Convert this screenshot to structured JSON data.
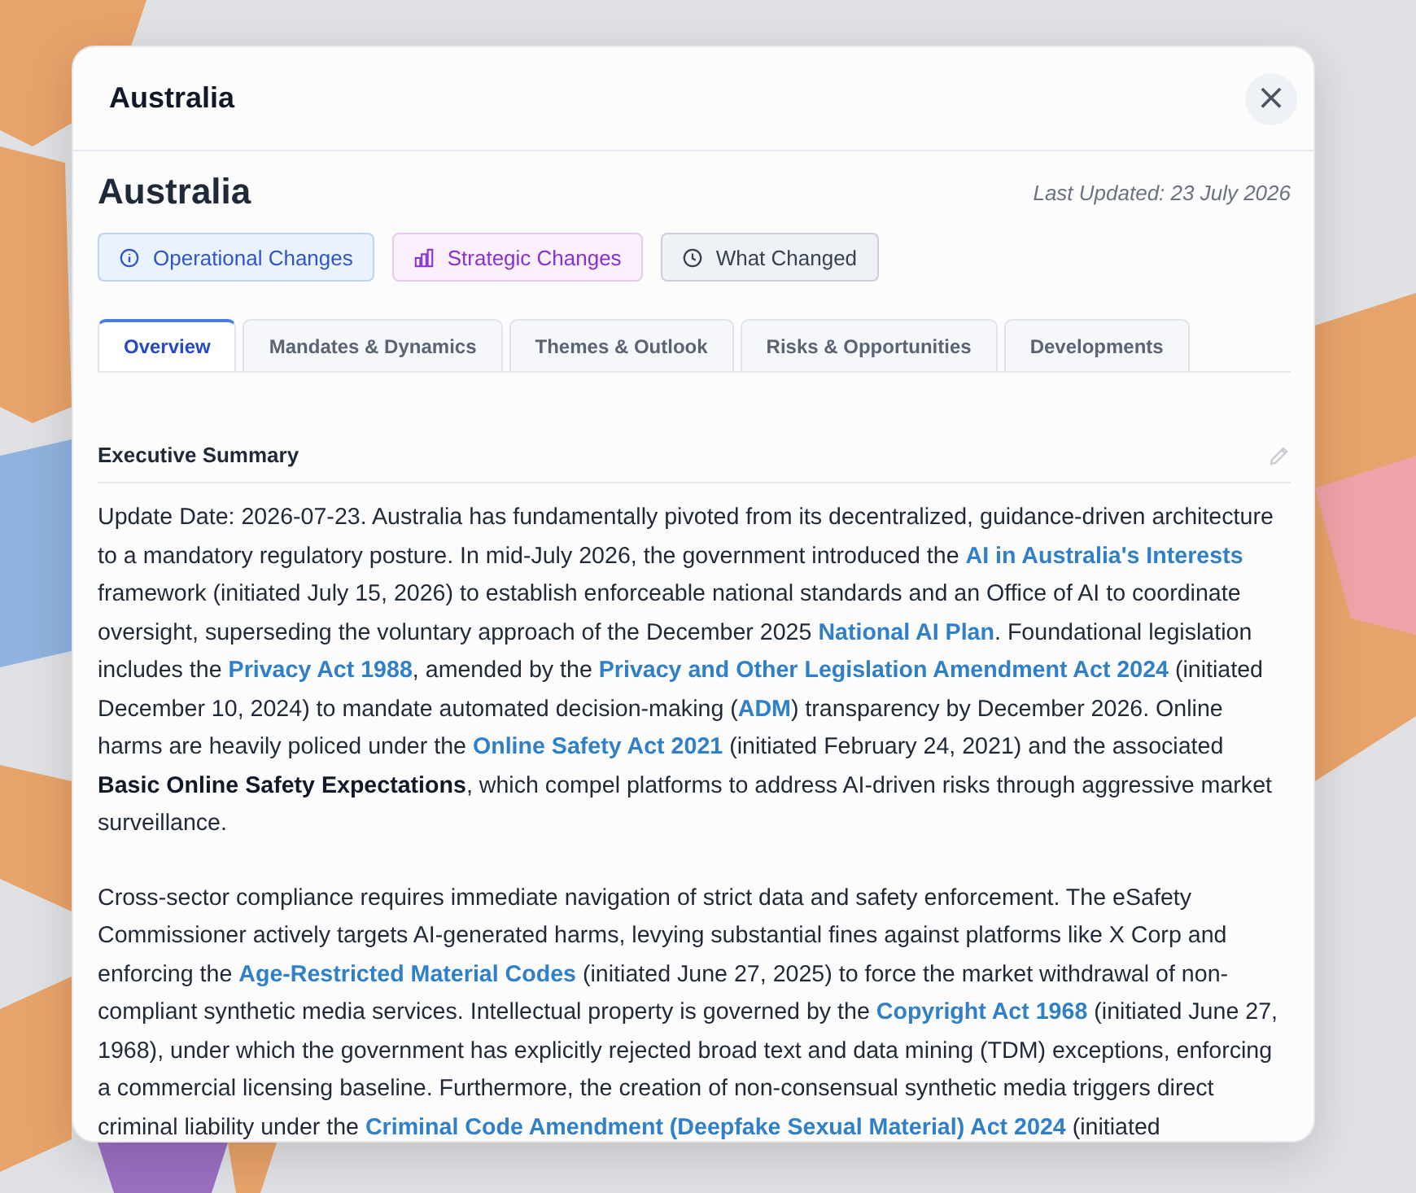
{
  "modal": {
    "title": "Australia",
    "close_icon": "×"
  },
  "country": {
    "name": "Australia",
    "last_updated": "Last Updated: 23 July 2026"
  },
  "actions": [
    {
      "kind": "info",
      "label": "Operational Changes"
    },
    {
      "kind": "chart",
      "label": "Strategic Changes"
    },
    {
      "kind": "clock",
      "label": "What Changed"
    }
  ],
  "tabs": [
    {
      "label": "Overview",
      "selected": true
    },
    {
      "label": "Mandates & Dynamics",
      "selected": false
    },
    {
      "label": "Themes & Outlook",
      "selected": false
    },
    {
      "label": "Risks & Opportunities",
      "selected": false
    },
    {
      "label": "Developments",
      "selected": false
    }
  ],
  "section": {
    "title": "Executive Summary",
    "paragraphs": [
      [
        {
          "kind": "text",
          "text": "Update Date: 2026-07-23. Australia has fundamentally pivoted from its decentralized, guidance-driven architecture to a mandatory regulatory posture. In mid-July 2026, the government introduced the "
        },
        {
          "kind": "link",
          "text": "AI in Australia's Interests"
        },
        {
          "kind": "text",
          "text": " framework (initiated July 15, 2026) to establish enforceable national standards and an Office of AI to coordinate oversight, superseding the voluntary approach of the December 2025 "
        },
        {
          "kind": "link",
          "text": "National AI Plan"
        },
        {
          "kind": "text",
          "text": ". Foundational legislation includes the "
        },
        {
          "kind": "link",
          "text": "Privacy Act 1988"
        },
        {
          "kind": "text",
          "text": ", amended by the "
        },
        {
          "kind": "link",
          "text": "Privacy and Other Legislation Amendment Act 2024"
        },
        {
          "kind": "text",
          "text": " (initiated December 10, 2024) to mandate automated decision-making ("
        },
        {
          "kind": "link",
          "text": "ADM"
        },
        {
          "kind": "text",
          "text": ") transparency by December 2026. Online harms are heavily policed under the "
        },
        {
          "kind": "link",
          "text": "Online Safety Act 2021"
        },
        {
          "kind": "text",
          "text": " (initiated February 24, 2021) and the associated "
        },
        {
          "kind": "bold",
          "text": "Basic Online Safety Expectations"
        },
        {
          "kind": "text",
          "text": ", which compel platforms to address AI-driven risks through aggressive market surveillance."
        }
      ],
      [
        {
          "kind": "text",
          "text": "Cross-sector compliance requires immediate navigation of strict data and safety enforcement. The eSafety Commissioner actively targets AI-generated harms, levying substantial fines against platforms like X Corp and enforcing the "
        },
        {
          "kind": "link",
          "text": "Age-Restricted Material Codes"
        },
        {
          "kind": "text",
          "text": " (initiated June 27, 2025) to force the market withdrawal of non-compliant synthetic media services. Intellectual property is governed by the "
        },
        {
          "kind": "link",
          "text": "Copyright Act 1968"
        },
        {
          "kind": "text",
          "text": " (initiated June 27, 1968), under which the government has explicitly rejected broad text and data mining (TDM) exceptions, enforcing a commercial licensing baseline. Furthermore, the creation of non-consensual synthetic media triggers direct criminal liability under the "
        },
        {
          "kind": "link",
          "text": "Criminal Code Amendment (Deepfake Sexual Material) Act 2024"
        },
        {
          "kind": "text",
          "text": " (initiated"
        }
      ]
    ]
  }
}
